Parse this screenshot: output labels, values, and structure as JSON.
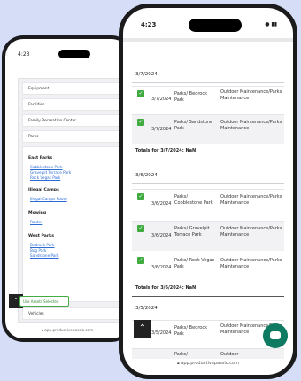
{
  "back_phone": {
    "time": "4:23",
    "filter_rows": [
      "Equipment",
      "Facilities",
      "Family Recreation Center",
      "Parks"
    ],
    "groups": [
      {
        "title": "East Parks",
        "links": [
          "Cobblestone Park",
          "Gravelpit Terrace Park",
          "Rock Vegas Park"
        ]
      },
      {
        "title": "Illegal Camps",
        "links": [
          "Illegal Camps Route"
        ]
      },
      {
        "title": "Mowing",
        "links": [
          "Routes"
        ]
      },
      {
        "title": "West Parks",
        "links": [
          "Bedrock Park",
          "Bog Park",
          "Sandstone Park"
        ]
      }
    ],
    "vehicles_row": "Vehicles",
    "button_label": "Use Assets Selected",
    "url": "app.productivepassio.com"
  },
  "front_phone": {
    "time": "4:23",
    "status_icons": "● ▮▮",
    "sections": [
      {
        "date": "3/7/2024",
        "rows": [
          {
            "date": "3/7/2024",
            "park": "Parks/ Bedrock Park",
            "activity": "Outdoor Maintenance/Parks Maintenance"
          },
          {
            "date": "3/7/2024",
            "park": "Parks/ Sandstone Park",
            "activity": "Outdoor Maintenance/Parks Maintenance"
          }
        ],
        "totals": "Totals for 3/7/2024: NaN"
      },
      {
        "date": "3/6/2024",
        "rows": [
          {
            "date": "3/6/2024",
            "park": "Parks/ Cobblestone Park",
            "activity": "Outdoor Maintenance/Parks Maintenance"
          },
          {
            "date": "3/6/2024",
            "park": "Parks/ Gravelpit Terrace Park",
            "activity": "Outdoor Maintenance/Parks Maintenance"
          },
          {
            "date": "3/6/2024",
            "park": "Parks/ Rock Vegas Park",
            "activity": "Outdoor Maintenance/Parks Maintenance"
          }
        ],
        "totals": "Totals for 3/6/2024: NaN"
      },
      {
        "date": "3/5/2024",
        "rows": [
          {
            "date": "3/5/2024",
            "park": "Parks/ Bedrock Park",
            "activity": "Outdoor Maintenance/Parks Maintenance"
          },
          {
            "date": "",
            "park": "Parks/",
            "activity": "Outdoor"
          }
        ]
      }
    ],
    "url": "app.productivepassio.com"
  },
  "colors": {
    "background": "#d6ddf7",
    "check_green": "#3faa3f",
    "chat_teal": "#0f7a62"
  },
  "icons": {
    "scroll_up": "chevron-up-icon",
    "chat": "chat-icon",
    "check": "check-icon",
    "lock": "lock-icon"
  }
}
